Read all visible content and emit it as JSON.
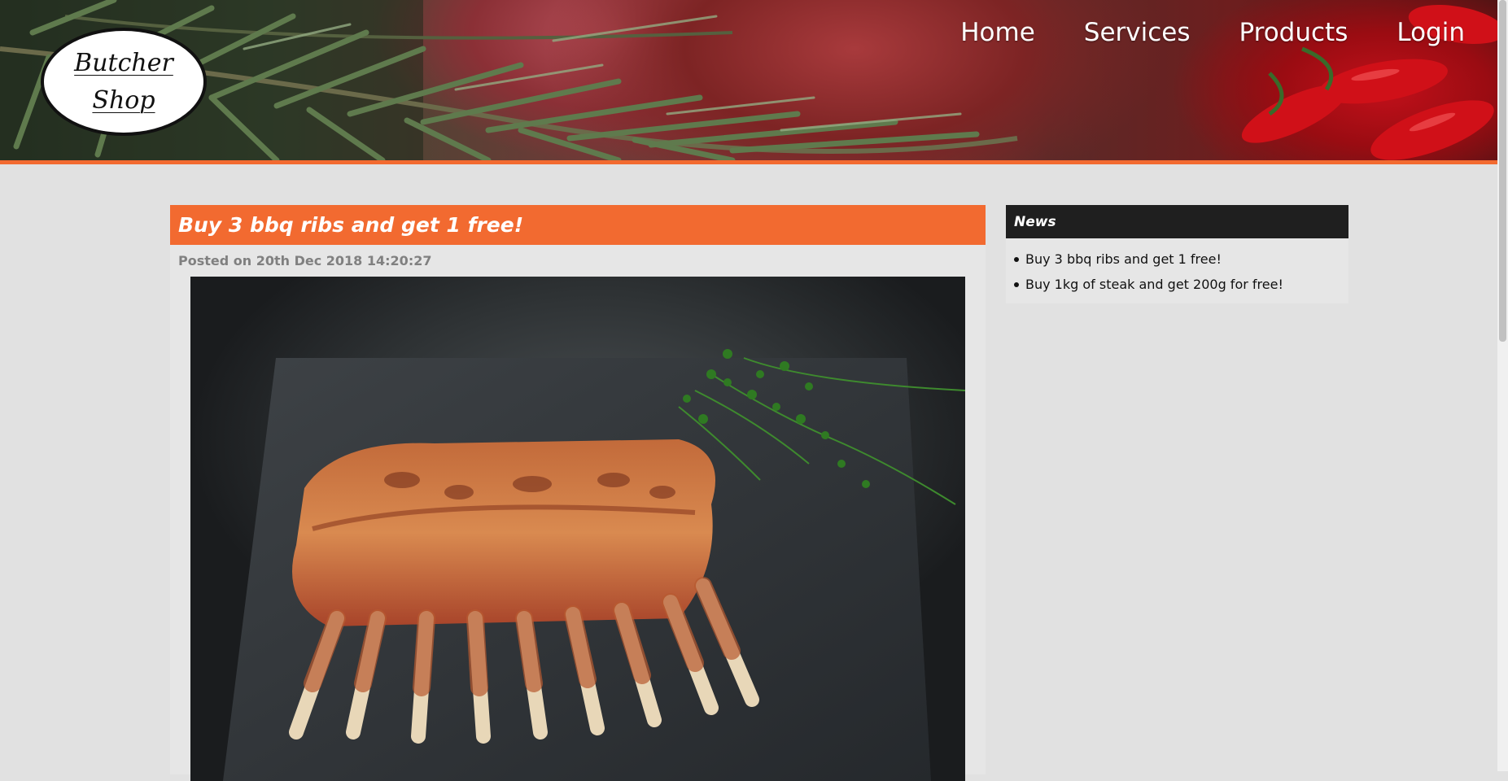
{
  "logo": {
    "line1": "Butcher",
    "line2": "Shop"
  },
  "nav": {
    "items": [
      "Home",
      "Services",
      "Products",
      "Login"
    ]
  },
  "post": {
    "title": "Buy 3 bbq ribs and get 1 free!",
    "meta": "Posted on 20th Dec 2018 14:20:27"
  },
  "sidebar": {
    "title": "News",
    "items": [
      "Buy 3 bbq ribs and get 1 free!",
      "Buy 1kg of steak and get 200g for free!"
    ]
  },
  "colors": {
    "accent": "#f26a30",
    "sidebar_header": "#1f1f1f",
    "background": "#e1e1e1"
  },
  "icons": [
    "rosemary-image",
    "ribs-image"
  ]
}
